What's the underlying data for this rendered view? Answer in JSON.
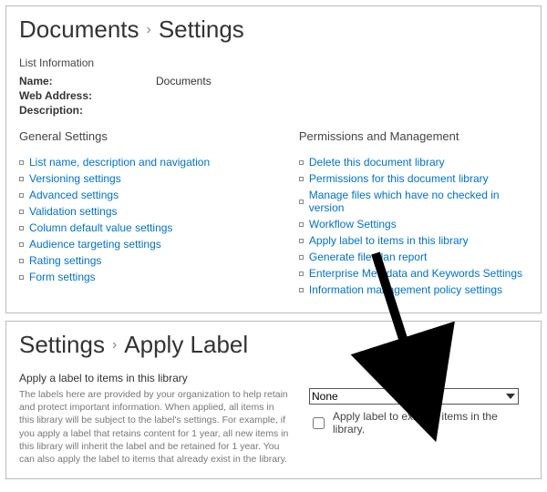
{
  "top": {
    "crumb1": "Documents",
    "crumb2": "Settings",
    "info_heading": "List Information",
    "labels": {
      "name": "Name:",
      "web": "Web Address:",
      "desc": "Description:"
    },
    "values": {
      "name": "Documents",
      "web": "",
      "desc": ""
    },
    "general_heading": "General Settings",
    "perm_heading": "Permissions and Management",
    "general_links": [
      "List name, description and navigation",
      "Versioning settings",
      "Advanced settings",
      "Validation settings",
      "Column default value settings",
      "Audience targeting settings",
      "Rating settings",
      "Form settings"
    ],
    "perm_links": [
      "Delete this document library",
      "Permissions for this document library",
      "Manage files which have no checked in version",
      "Workflow Settings",
      "Apply label to items in this library",
      "Generate file plan report",
      "Enterprise Metadata and Keywords Settings",
      "Information management policy settings"
    ]
  },
  "bottom": {
    "crumb1": "Settings",
    "crumb2": "Apply Label",
    "heading": "Apply a label to items in this library",
    "desc": "The labels here are provided by your organization to help retain and protect important information. When applied, all items in this library will be subject to the label's settings. For example, if you apply a label that retains content for 1 year, all new items in this library will inherit the label and be retained for 1 year. You can also apply the label to items that already exist in the library.",
    "select_value": "None",
    "checkbox_label": "Apply label to existing items in the library."
  }
}
